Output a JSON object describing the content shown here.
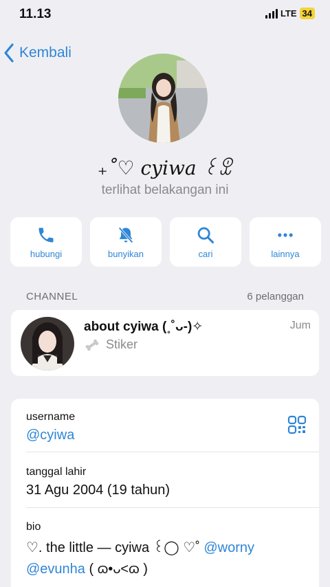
{
  "status_bar": {
    "time": "11.13",
    "network": "LTE",
    "battery": "34"
  },
  "nav": {
    "back_label": "Kembali"
  },
  "profile": {
    "name": "₊˚♡ cyiwa ꒰ꀾ",
    "status": "terlihat belakangan ini"
  },
  "actions": [
    {
      "label": "hubungi",
      "icon": "phone-icon"
    },
    {
      "label": "bunyikan",
      "icon": "bell-muted-icon"
    },
    {
      "label": "cari",
      "icon": "search-icon"
    },
    {
      "label": "lainnya",
      "icon": "more-icon"
    }
  ],
  "channel": {
    "section_label": "CHANNEL",
    "subscribers": "6 pelanggan",
    "title": "about cyiwa (˳˚ᴗ-)✧",
    "time": "Jum",
    "subtitle": "Stiker"
  },
  "info": {
    "username_label": "username",
    "username_value": "@cyiwa",
    "birthday_label": "tanggal lahir",
    "birthday_value": "31 Agu 2004 (19 tahun)",
    "bio_label": "bio",
    "bio_text_1": "♡. the little — cyiwa ꒰◯ ♡˚ ",
    "bio_link_1": "@worny",
    "bio_link_2": "@evunha",
    "bio_text_2": " ( ɷ•ᴗ<ɷ )"
  },
  "colors": {
    "accent": "#2f86d6",
    "background": "#efeff3",
    "card": "#ffffff",
    "secondary_text": "#8a8a8e"
  }
}
